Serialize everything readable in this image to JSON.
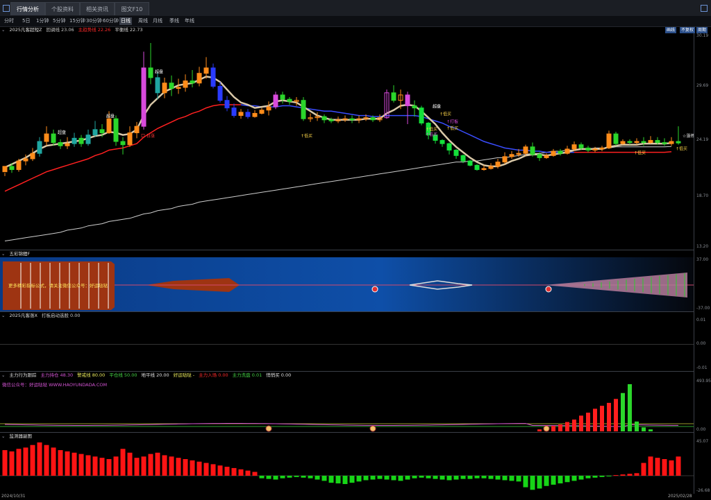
{
  "tabs": [
    "行情分析",
    "个股资料",
    "相关资讯",
    "图文F10"
  ],
  "periods": [
    "分时",
    "5日",
    "1分钟",
    "5分钟",
    "15分钟",
    "30分钟",
    "60分钟",
    "日线",
    "周线",
    "月线",
    "季线",
    "年线"
  ],
  "active_period": "日线",
  "right_buttons": {
    "draw": "画线",
    "adjust": "不复权",
    "cycle": "周期"
  },
  "main_panel": {
    "title": "2025凡客超短Z",
    "items": [
      {
        "label": "回调线 23.06",
        "color": "#c8c8c8"
      },
      {
        "label": "主趋势线 22.26",
        "color": "#ff2a2a"
      },
      {
        "label": "平衡线 22.73",
        "color": "#d8d8d8"
      }
    ],
    "y_ticks": [
      "30.19",
      "29.69",
      "24.19",
      "18.70",
      "13.20"
    ],
    "labels": [
      "超盘",
      "超盘",
      "超盘",
      "超盘",
      "口 日涨",
      "↑低买",
      "↑低买",
      "↑低买",
      "↑低买",
      "↑低买",
      "↑低买",
      "☆涨停",
      "↑低买",
      "↑打板",
      "口口超涨",
      "口口超涨"
    ]
  },
  "wucai_panel": {
    "title": "五彩锦鲤F",
    "banner_text": "更多精彩指标公式，请关注微信公众号：好运哒哒",
    "y_ticks": [
      "37.00",
      "-37.00"
    ]
  },
  "zt_panel": {
    "title": "2025凡客涨X",
    "items": [
      {
        "label": "打板启动选股 0.00",
        "color": "#c8c8c8"
      }
    ],
    "y_ticks": [
      "0.01",
      "0.00",
      "-0.01"
    ]
  },
  "flow_panel": {
    "title": "主力行为跟踪",
    "items": [
      {
        "label": "主力持仓 48.30",
        "color": "#d454d4"
      },
      {
        "label": "警戒线 80.00",
        "color": "#e8e85a"
      },
      {
        "label": "平仓线 50.00",
        "color": "#44d444"
      },
      {
        "label": "地平线 20.00",
        "color": "#e0e0e0"
      },
      {
        "label": "好运哒哒 -",
        "color": "#e8e85a"
      },
      {
        "label": "主力入场 0.00",
        "color": "#ff2a2a"
      },
      {
        "label": "主力洗盘 0.01",
        "color": "#44d444"
      },
      {
        "label": "悄悄买 0.00",
        "color": "#e0e0e0"
      }
    ],
    "watermark": "微信公众号：好运哒哒 WWW.HAOYUNDADA.COM",
    "y_ticks": [
      "493.95",
      "0.00"
    ]
  },
  "monitor_panel": {
    "title": "监测器副图",
    "y_ticks": [
      "45.07",
      "-26.68"
    ]
  },
  "dates": {
    "start": "2024/10/31",
    "end": "2025/02/28"
  },
  "chart_data": {
    "type": "candlestick",
    "candles": [
      [
        20.4,
        20.9,
        20.3,
        20.0
      ],
      [
        20.9,
        20.6,
        21.2,
        20.3
      ],
      [
        20.6,
        21.4,
        21.6,
        20.4
      ],
      [
        21.4,
        21.6,
        22.0,
        21.0
      ],
      [
        21.6,
        22.1,
        22.6,
        21.4
      ],
      [
        22.1,
        23.2,
        23.6,
        21.8
      ],
      [
        23.2,
        23.9,
        24.6,
        22.8
      ],
      [
        23.9,
        23.1,
        24.3,
        22.8
      ],
      [
        23.1,
        22.8,
        23.4,
        22.5
      ],
      [
        22.8,
        23.0,
        23.6,
        22.5
      ],
      [
        23.0,
        23.5,
        24.0,
        22.7
      ],
      [
        23.5,
        23.0,
        23.8,
        22.7
      ],
      [
        23.0,
        23.8,
        24.3,
        22.8
      ],
      [
        23.8,
        24.3,
        25.1,
        23.6
      ],
      [
        24.3,
        24.0,
        24.8,
        23.6
      ],
      [
        24.0,
        25.3,
        26.0,
        23.9
      ],
      [
        25.3,
        23.2,
        25.6,
        22.8
      ],
      [
        23.2,
        22.9,
        23.6,
        22.0
      ],
      [
        22.9,
        24.0,
        24.6,
        22.7
      ],
      [
        24.0,
        24.6,
        25.0,
        23.5
      ],
      [
        24.6,
        30.0,
        31.5,
        24.3
      ],
      [
        30.0,
        29.1,
        32.3,
        28.5
      ],
      [
        29.1,
        27.7,
        29.6,
        27.1
      ],
      [
        27.7,
        28.6,
        29.1,
        27.2
      ],
      [
        28.6,
        28.1,
        29.3,
        27.4
      ],
      [
        28.1,
        28.2,
        29.0,
        27.6
      ],
      [
        28.2,
        28.8,
        29.4,
        27.8
      ],
      [
        28.8,
        28.6,
        29.8,
        28.2
      ],
      [
        28.6,
        29.5,
        30.1,
        28.3
      ],
      [
        29.5,
        30.0,
        31.0,
        29.0
      ],
      [
        30.0,
        28.3,
        30.4,
        28.1
      ],
      [
        28.3,
        27.0,
        28.7,
        26.8
      ],
      [
        27.0,
        26.3,
        27.4,
        26.0
      ],
      [
        26.3,
        25.6,
        26.7,
        25.4
      ],
      [
        25.6,
        25.9,
        26.2,
        25.3
      ],
      [
        25.9,
        25.5,
        26.2,
        25.3
      ],
      [
        25.5,
        25.8,
        26.1,
        25.4
      ],
      [
        25.8,
        26.1,
        26.3,
        25.7
      ],
      [
        26.1,
        26.4,
        26.9,
        25.6
      ],
      [
        26.4,
        27.5,
        27.8,
        26.2
      ],
      [
        27.5,
        27.1,
        27.8,
        26.7
      ],
      [
        27.1,
        26.9,
        27.3,
        26.6
      ],
      [
        26.9,
        27.0,
        27.3,
        26.5
      ],
      [
        27.0,
        25.3,
        27.3,
        25.1
      ],
      [
        25.3,
        25.4,
        25.8,
        25.0
      ],
      [
        25.4,
        25.5,
        25.9,
        25.1
      ],
      [
        25.5,
        25.2,
        25.7,
        24.9
      ],
      [
        25.2,
        25.1,
        25.4,
        24.9
      ],
      [
        25.1,
        25.2,
        25.5,
        24.9
      ],
      [
        25.2,
        25.3,
        25.6,
        25.0
      ],
      [
        25.3,
        25.2,
        25.6,
        24.9
      ],
      [
        25.2,
        25.3,
        25.6,
        24.9
      ],
      [
        25.3,
        25.4,
        25.7,
        25.1
      ],
      [
        25.4,
        25.2,
        25.6,
        25.0
      ],
      [
        25.2,
        25.4,
        25.7,
        25.0
      ],
      [
        25.4,
        27.7,
        28.0,
        25.3
      ],
      [
        27.7,
        27.0,
        28.4,
        26.8
      ],
      [
        27.0,
        27.5,
        28.0,
        26.2
      ],
      [
        27.5,
        26.5,
        27.8,
        24.8
      ],
      [
        26.5,
        26.3,
        27.0,
        25.5
      ],
      [
        26.3,
        24.9,
        26.5,
        24.7
      ],
      [
        24.9,
        23.8,
        25.0,
        23.4
      ],
      [
        23.8,
        23.3,
        24.0,
        23.0
      ],
      [
        23.3,
        23.0,
        23.4,
        22.7
      ],
      [
        23.0,
        22.4,
        23.1,
        22.0
      ],
      [
        22.4,
        21.9,
        22.5,
        21.6
      ],
      [
        21.9,
        21.4,
        22.0,
        21.2
      ],
      [
        21.4,
        21.0,
        21.5,
        20.9
      ],
      [
        21.0,
        20.6,
        21.1,
        20.5
      ],
      [
        20.6,
        20.7,
        21.0,
        20.5
      ],
      [
        20.7,
        20.9,
        21.2,
        20.6
      ],
      [
        20.9,
        21.3,
        21.6,
        20.7
      ],
      [
        21.3,
        21.8,
        22.2,
        21.1
      ],
      [
        21.8,
        22.0,
        22.3,
        21.6
      ],
      [
        22.0,
        22.1,
        22.5,
        21.8
      ],
      [
        22.1,
        22.7,
        22.9,
        21.9
      ],
      [
        22.7,
        22.0,
        23.1,
        21.8
      ],
      [
        22.0,
        21.7,
        22.2,
        21.4
      ],
      [
        21.7,
        21.9,
        22.1,
        21.6
      ],
      [
        21.9,
        22.3,
        22.5,
        21.8
      ],
      [
        22.3,
        22.1,
        22.5,
        21.9
      ],
      [
        22.1,
        22.5,
        22.8,
        22.0
      ],
      [
        22.5,
        22.9,
        23.2,
        22.3
      ],
      [
        22.9,
        22.6,
        23.1,
        22.4
      ],
      [
        22.6,
        22.4,
        22.8,
        22.2
      ],
      [
        22.4,
        22.5,
        22.7,
        22.2
      ],
      [
        22.5,
        22.6,
        22.8,
        22.3
      ],
      [
        22.6,
        23.9,
        24.2,
        22.5
      ],
      [
        23.9,
        23.0,
        24.1,
        22.8
      ],
      [
        23.0,
        23.2,
        23.4,
        22.9
      ],
      [
        23.2,
        23.1,
        23.4,
        22.9
      ],
      [
        23.1,
        23.2,
        23.5,
        22.9
      ],
      [
        23.2,
        23.1,
        23.6,
        22.8
      ],
      [
        23.1,
        23.3,
        23.7,
        23.0
      ],
      [
        23.3,
        23.1,
        23.6,
        22.9
      ],
      [
        23.1,
        23.0,
        23.5,
        22.8
      ],
      [
        23.0,
        23.2,
        23.6,
        22.8
      ],
      [
        23.2,
        23.06,
        24.6,
        22.9
      ]
    ],
    "highlight_days": [
      20,
      39,
      55,
      58
    ],
    "band_line": [
      20.8,
      21.1,
      21.4,
      21.7,
      22.1,
      22.5,
      22.8,
      22.9,
      23.0,
      23.1,
      23.2,
      23.3,
      23.5,
      23.7,
      23.8,
      24.1,
      24.0,
      23.8,
      23.9,
      24.3,
      25.6,
      26.6,
      27.2,
      27.8,
      28.1,
      28.4,
      28.5,
      28.6,
      28.9,
      29.2,
      29.1,
      28.7,
      28.0,
      27.3,
      26.8,
      26.6,
      26.3,
      26.4,
      26.5,
      26.9,
      27.0,
      26.9,
      26.8,
      26.4,
      26.0,
      25.6,
      25.4,
      25.2,
      25.2,
      25.2,
      25.2,
      25.2,
      25.3,
      25.3,
      25.3,
      25.8,
      26.1,
      26.5,
      26.6,
      26.5,
      26.0,
      25.4,
      24.8,
      24.0,
      23.3,
      22.7,
      22.2,
      21.7,
      21.3,
      21.0,
      20.9,
      20.9,
      21.1,
      21.4,
      21.6,
      21.9,
      22.0,
      22.0,
      21.9,
      22.0,
      22.1,
      22.2,
      22.4,
      22.5,
      22.5,
      22.5,
      22.5,
      22.7,
      22.8,
      22.9,
      22.9,
      22.9,
      23.0,
      23.0,
      23.0,
      23.0,
      23.06
    ],
    "trend_line": [
      18.6,
      18.9,
      19.2,
      19.5,
      19.8,
      20.1,
      20.4,
      20.6,
      20.8,
      21.0,
      21.2,
      21.4,
      21.6,
      21.9,
      22.1,
      22.4,
      22.5,
      22.6,
      22.8,
      23.0,
      23.6,
      24.0,
      24.4,
      24.7,
      25.0,
      25.3,
      25.5,
      25.8,
      26.0,
      26.3,
      26.5,
      26.6,
      26.6,
      26.6,
      26.6,
      26.5,
      26.5,
      26.4,
      26.4,
      26.4,
      26.5,
      26.5,
      26.4,
      26.3,
      26.2,
      26.1,
      26.0,
      26.0,
      25.9,
      25.8,
      25.7,
      25.6,
      25.6,
      25.5,
      25.5,
      25.6,
      25.6,
      25.6,
      25.6,
      25.6,
      25.5,
      25.3,
      25.1,
      24.9,
      24.6,
      24.4,
      24.1,
      23.8,
      23.5,
      23.2,
      23.0,
      22.8,
      22.6,
      22.5,
      22.4,
      22.4,
      22.3,
      22.3,
      22.2,
      22.2,
      22.2,
      22.2,
      22.2,
      22.2,
      22.2,
      22.2,
      22.2,
      22.2,
      22.2,
      22.2,
      22.2,
      22.2,
      22.2,
      22.2,
      22.2,
      22.2,
      22.26
    ],
    "balance_line": [
      14.0,
      14.1,
      14.2,
      14.3,
      14.4,
      14.5,
      14.6,
      14.7,
      14.8,
      15.0,
      15.1,
      15.2,
      15.4,
      15.5,
      15.6,
      15.8,
      15.9,
      16.0,
      16.1,
      16.3,
      16.5,
      16.6,
      16.8,
      16.9,
      17.0,
      17.2,
      17.3,
      17.4,
      17.6,
      17.7,
      17.8,
      17.9,
      18.0,
      18.1,
      18.2,
      18.3,
      18.4,
      18.5,
      18.6,
      18.7,
      18.8,
      18.9,
      19.0,
      19.1,
      19.2,
      19.3,
      19.4,
      19.5,
      19.6,
      19.7,
      19.8,
      19.9,
      20.0,
      20.1,
      20.2,
      20.3,
      20.4,
      20.5,
      20.6,
      20.7,
      20.8,
      20.9,
      21.0,
      21.1,
      21.2,
      21.3,
      21.3,
      21.4,
      21.4,
      21.5,
      21.6,
      21.7,
      21.7,
      21.8,
      21.9,
      22.0,
      22.1,
      22.1,
      22.2,
      22.3,
      22.3,
      22.4,
      22.4,
      22.5,
      22.5,
      22.6,
      22.6,
      22.6,
      22.7,
      22.7,
      22.7,
      22.7,
      22.7,
      22.7,
      22.7,
      22.7,
      22.73
    ],
    "flow_bars": [
      0,
      0,
      0,
      0,
      0,
      0,
      0,
      0,
      0,
      0,
      0,
      0,
      0,
      0,
      0,
      0,
      0,
      0,
      0,
      0,
      0,
      0,
      0,
      0,
      0,
      0,
      0,
      0,
      0,
      0,
      0,
      0,
      0,
      0,
      0,
      0,
      0,
      0,
      0,
      0,
      0,
      0,
      0,
      0,
      0,
      0,
      0,
      0,
      0,
      0,
      0,
      0,
      0,
      0,
      0,
      0,
      0,
      0,
      0,
      0,
      0,
      0,
      0,
      0,
      0,
      0,
      0,
      0,
      0,
      0,
      0,
      0,
      0,
      0,
      0,
      0,
      0,
      20,
      40,
      55,
      70,
      95,
      120,
      160,
      190,
      230,
      260,
      290,
      330,
      390,
      480,
      100,
      40,
      20,
      0,
      0,
      0,
      0,
      0
    ],
    "monitor_bars": [
      40,
      38,
      42,
      44,
      48,
      52,
      48,
      44,
      40,
      38,
      36,
      34,
      32,
      30,
      28,
      26,
      30,
      42,
      36,
      28,
      30,
      34,
      36,
      32,
      30,
      28,
      26,
      24,
      22,
      20,
      18,
      16,
      14,
      12,
      10,
      8,
      6,
      -4,
      -5,
      -6,
      -4,
      -3,
      -2,
      -3,
      -4,
      -6,
      -8,
      -11,
      -12,
      -13,
      -11,
      -9,
      -7,
      -6,
      -5,
      -6,
      -7,
      -8,
      -6,
      -4,
      -3,
      -4,
      -5,
      -6,
      -7,
      -6,
      -5,
      -5,
      -4,
      -4,
      -5,
      -6,
      -7,
      -8,
      -9,
      -18,
      -22,
      -20,
      -16,
      -14,
      -12,
      -10,
      -8,
      -6,
      -4,
      -3,
      -2,
      -1,
      1,
      2,
      3,
      4,
      20,
      30,
      28,
      26,
      24,
      30
    ]
  }
}
